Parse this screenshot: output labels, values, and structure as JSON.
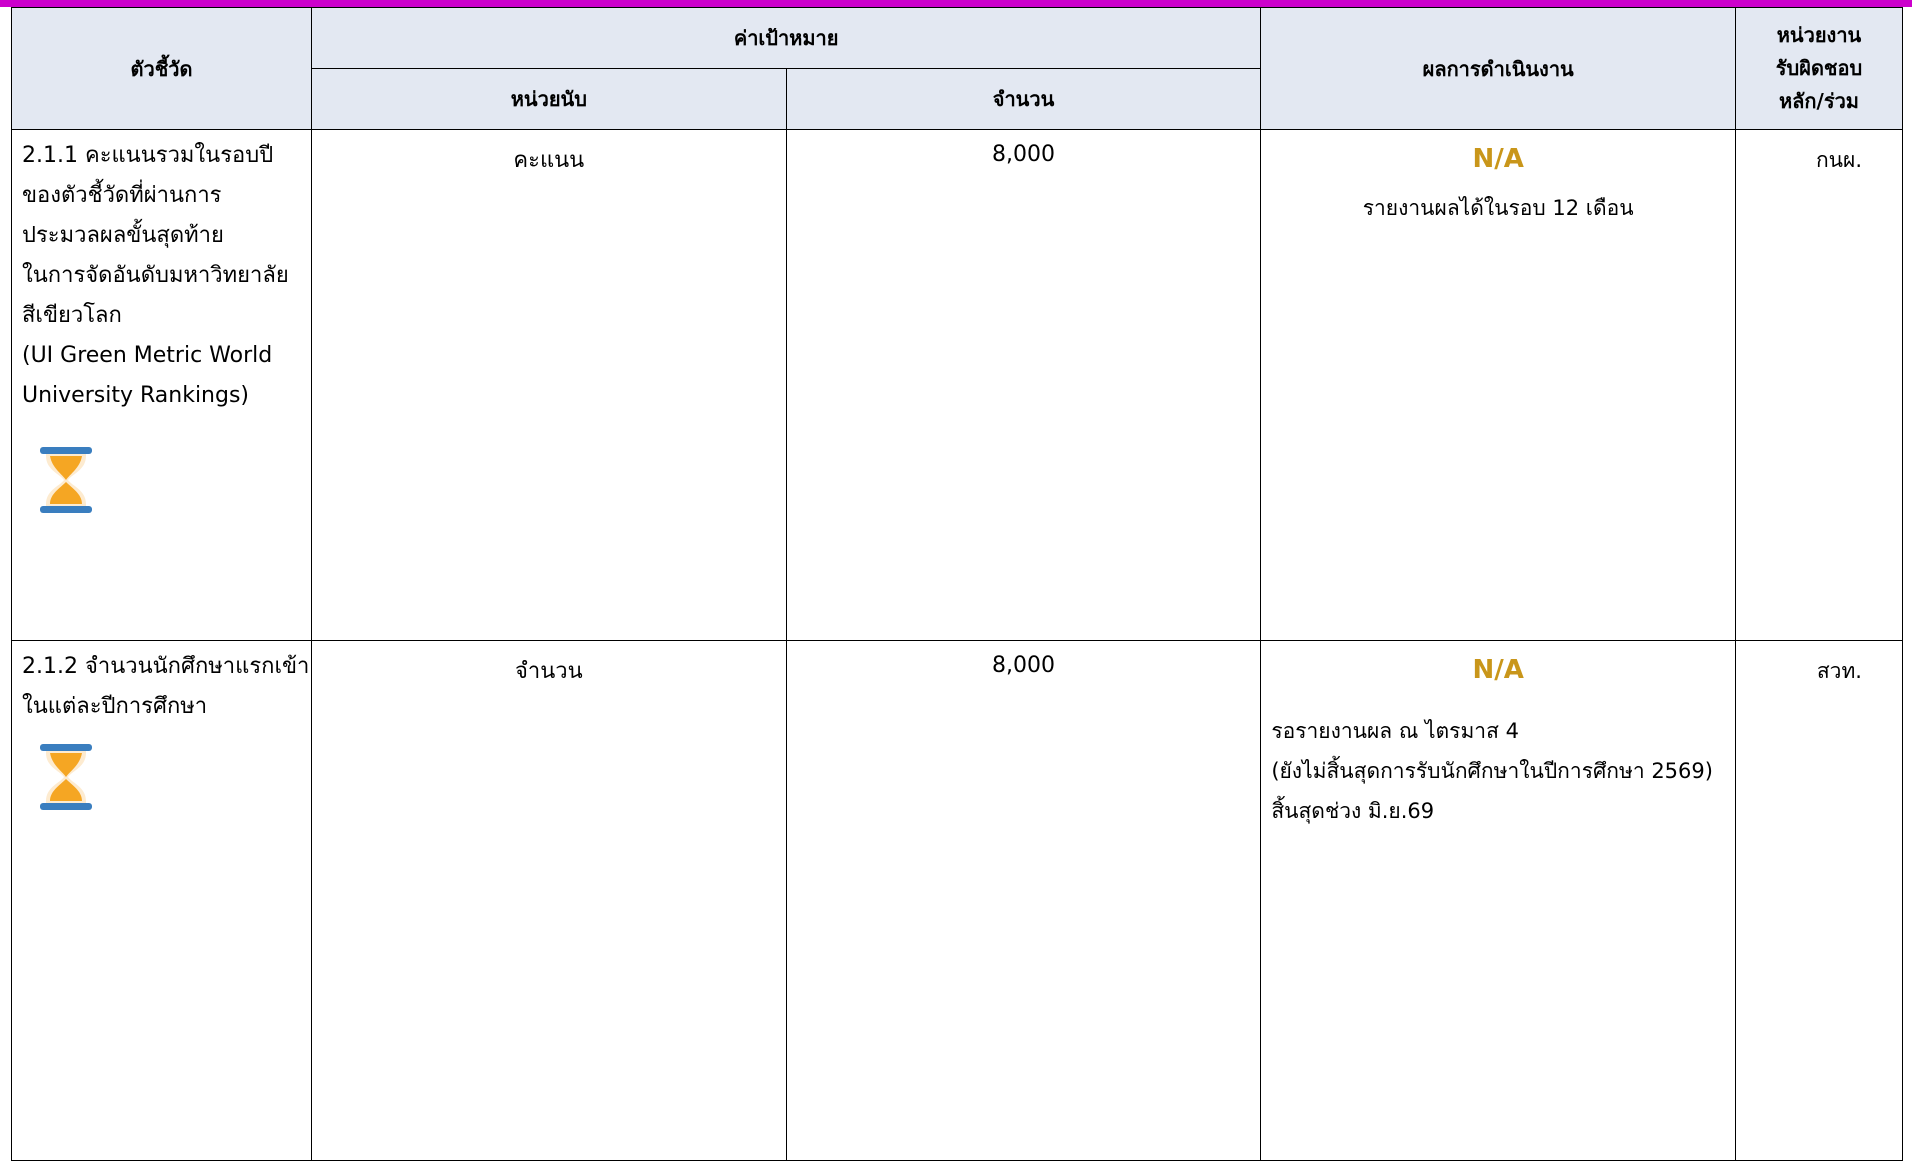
{
  "colors": {
    "top_bar": "#cc00cc",
    "header_bg": "#e3e8f2",
    "status_na": "#c9961a",
    "hourglass_sand": "#f5a623",
    "hourglass_frame": "#3a7ebf"
  },
  "header": {
    "indicator": "ตัวชี้วัด",
    "target": "ค่าเป้าหมาย",
    "unit": "หน่วยนับ",
    "amount": "จำนวน",
    "result": "ผลการดำเนินงาน",
    "org_lines": [
      "หน่วยงาน",
      "รับผิดชอบ",
      "หลัก/ร่วม"
    ]
  },
  "rows": [
    {
      "indicator_lines": [
        "2.1.1 คะแนนรวมในรอบปี",
        "ของตัวชี้วัดที่ผ่านการ",
        "ประมวลผลขั้นสุดท้าย",
        "ในการจัดอันดับมหาวิทยาลัย",
        "สีเขียวโลก",
        "(UI Green Metric World",
        "University Rankings)"
      ],
      "status_icon": "hourglass-icon",
      "unit": "คะแนน",
      "amount": "8,000",
      "result_status": "N/A",
      "result_notes": [
        "รายงานผลได้ในรอบ 12 เดือน"
      ],
      "org": "กนผ."
    },
    {
      "indicator_lines": [
        "2.1.2 จำนวนนักศึกษาแรกเข้า",
        "ในแต่ละปีการศึกษา"
      ],
      "status_icon": "hourglass-icon",
      "unit": "จำนวน",
      "amount": "8,000",
      "result_status": "N/A",
      "result_notes": [
        "รอรายงานผล ณ ไตรมาส 4",
        "(ยังไม่สิ้นสุดการรับนักศึกษาในปีการศึกษา 2569)",
        "สิ้นสุดช่วง มิ.ย.69"
      ],
      "org": "สวท."
    }
  ]
}
